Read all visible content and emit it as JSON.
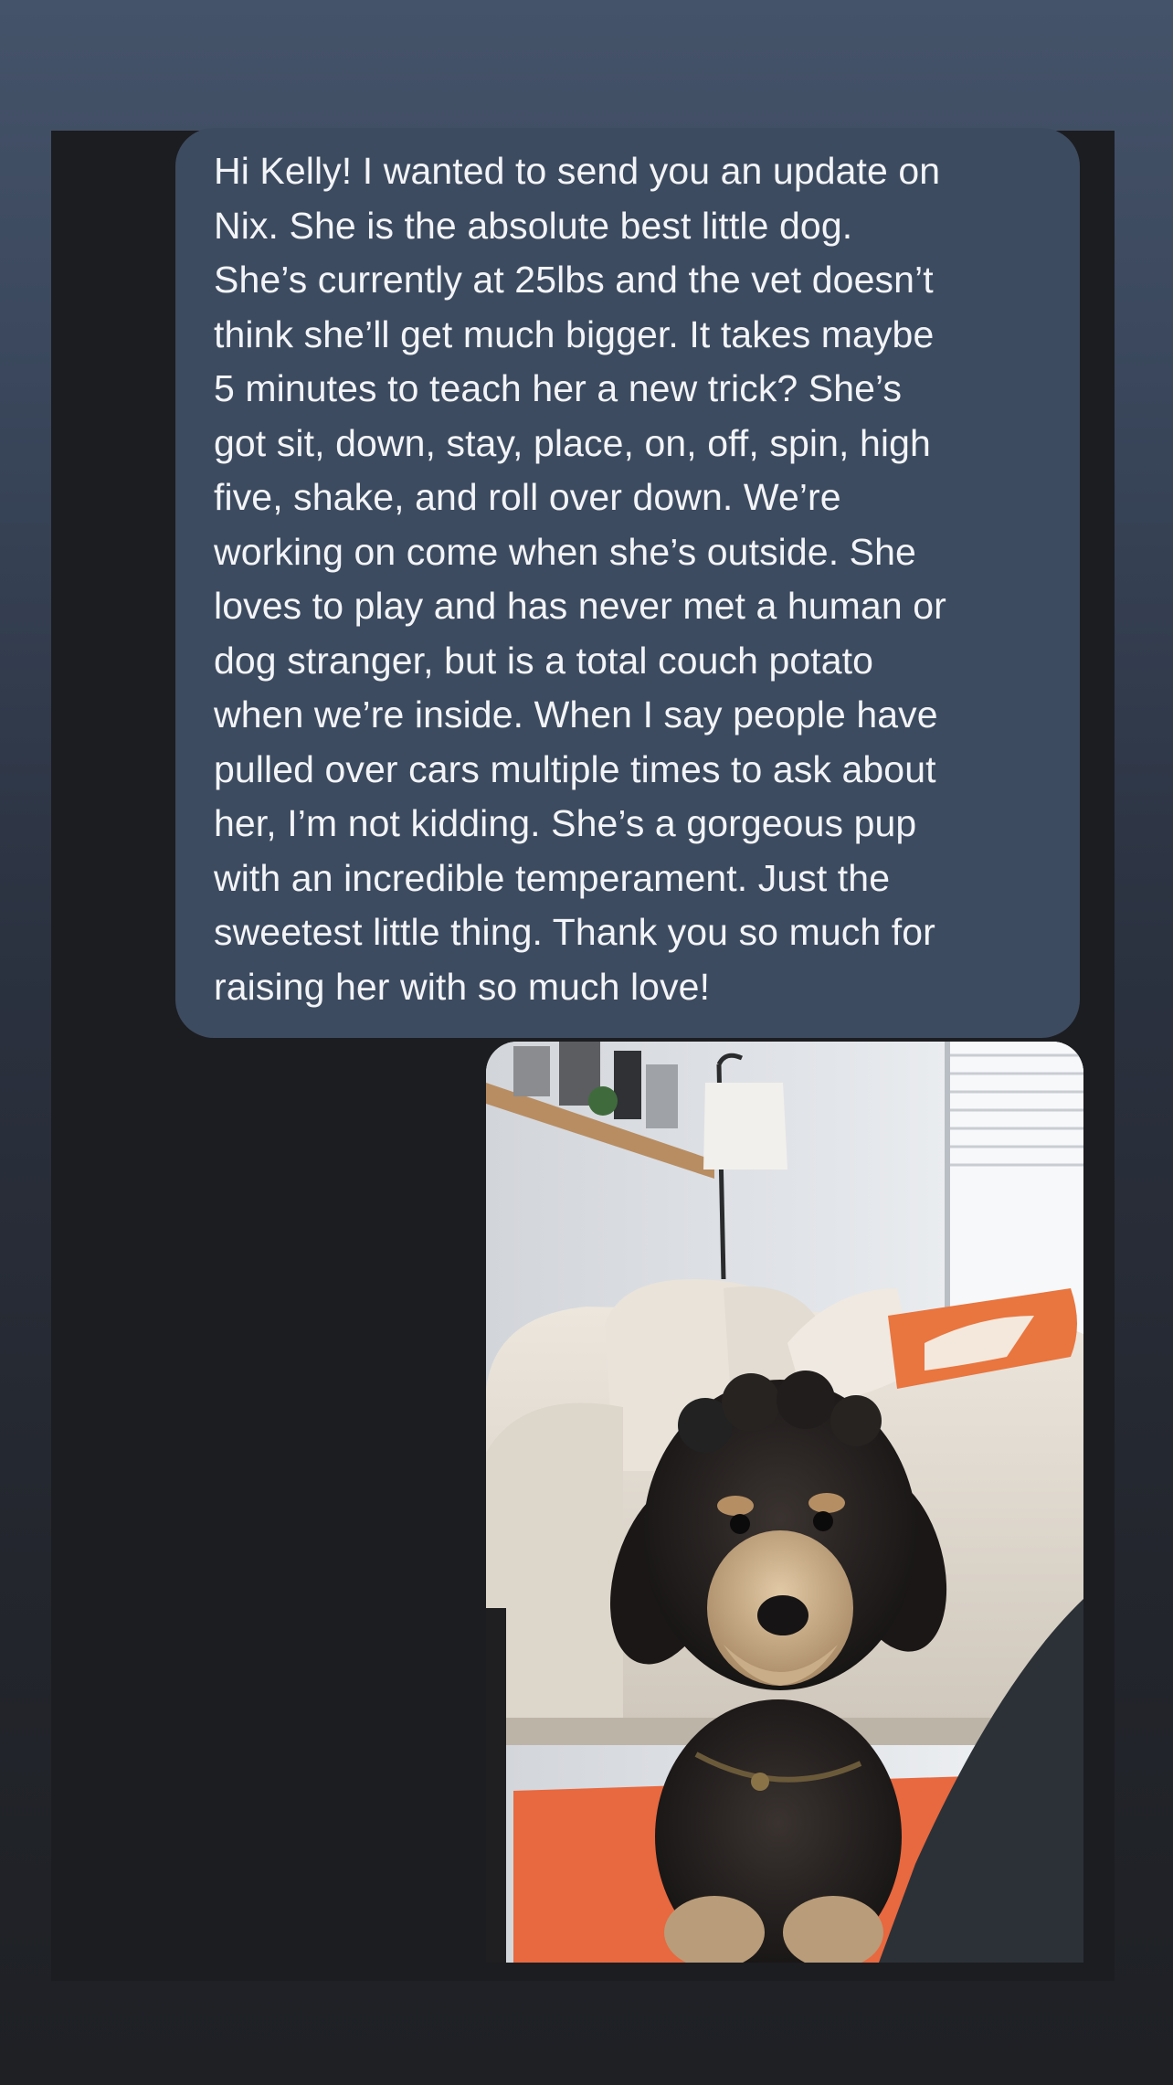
{
  "message": {
    "lines": [
      "Hi Kelly! I wanted to send you an update on",
      "Nix. She is the absolute best little dog.",
      "She’s currently at 25lbs and the vet doesn’t",
      "think she’ll get much bigger. It takes maybe",
      "5 minutes to teach her a new trick? She’s",
      "got sit, down, stay, place, on, off, spin, high",
      "five, shake, and roll over down. We’re",
      "working on come when she’s outside. She",
      "loves to play and has never met a human or",
      "dog stranger, but is a total couch potato",
      "when we’re inside. When I say people have",
      "pulled over cars multiple times to ask about",
      "her, I’m not kidding. She’s a gorgeous pup",
      "with an incredible temperament. Just the",
      "sweetest little thing. Thank you so much for",
      "raising her with so much love!"
    ]
  },
  "photo": {
    "subject": "small curly black-and-tan dog sitting on an orange rug in front of a beige couch"
  },
  "colors": {
    "bubble": "#3d4b60",
    "screen_background": "#1c1d21",
    "text": "#f2f4f7",
    "rug": "#e8683f"
  }
}
